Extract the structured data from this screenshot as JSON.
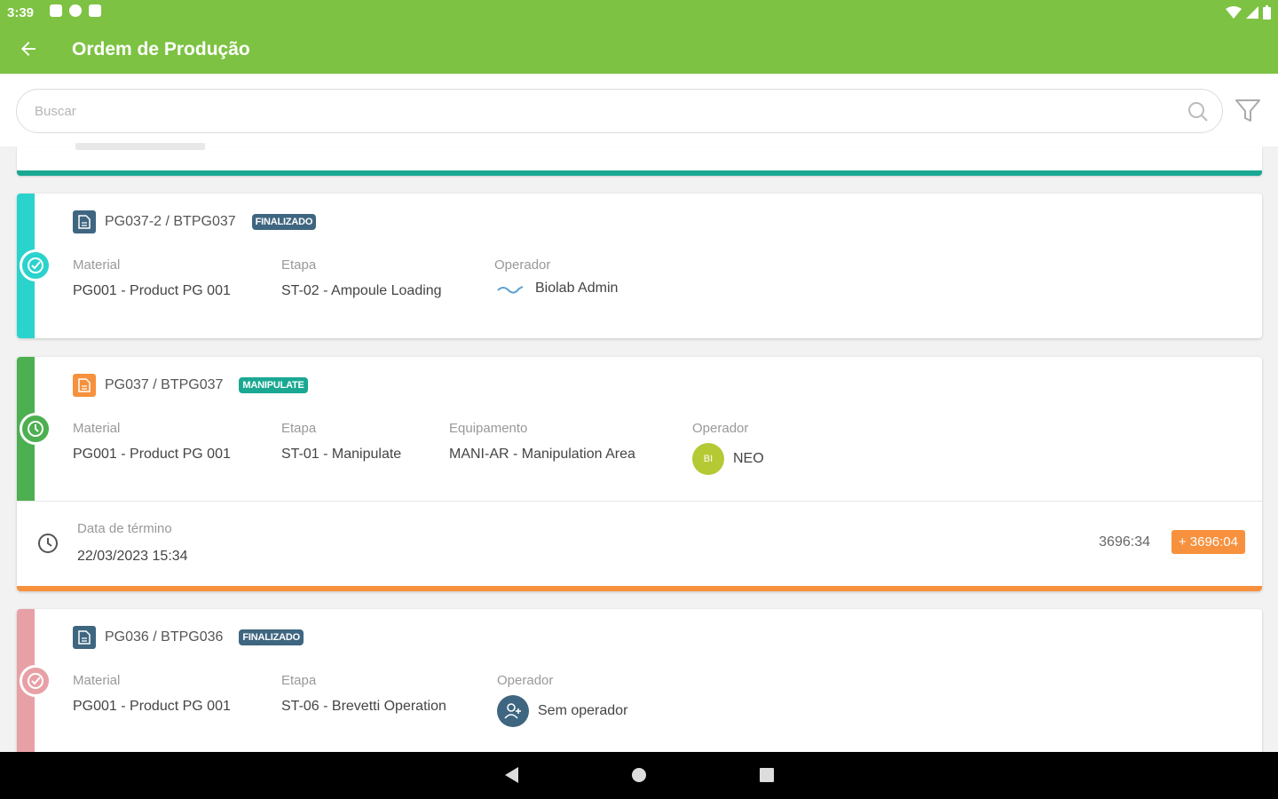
{
  "status_bar": {
    "time": "3:39"
  },
  "app_bar": {
    "title": "Ordem de Produção"
  },
  "search": {
    "placeholder": "Buscar"
  },
  "colors": {
    "brand": "#7dc242",
    "teal": "#2ad3cc",
    "green": "#4caf50",
    "pink": "#e7a1a6",
    "orange": "#f7913d",
    "badge_final": "#3f6680",
    "badge_manip": "#1aa893"
  },
  "cards": [
    {
      "code": "PG037-2 / BTPG037",
      "badge": "FINALIZADO",
      "material_label": "Material",
      "material": "PG001 - Product PG 001",
      "etapa_label": "Etapa",
      "etapa": "ST-02 - Ampoule Loading",
      "operador_label": "Operador",
      "operador": "Biolab Admin"
    },
    {
      "code": "PG037 / BTPG037",
      "badge": "MANIPULATE",
      "material_label": "Material",
      "material": "PG001 - Product PG 001",
      "etapa_label": "Etapa",
      "etapa": "ST-01 - Manipulate",
      "equip_label": "Equipamento",
      "equipamento": "MANI-AR - Manipulation Area",
      "operador_label": "Operador",
      "operador": "NEO",
      "operador_initials": "BI",
      "footer": {
        "label": "Data de término",
        "date": "22/03/2023 15:34",
        "duration": "3696:34",
        "late": "+ 3696:04"
      }
    },
    {
      "code": "PG036 / BTPG036",
      "badge": "FINALIZADO",
      "material_label": "Material",
      "material": "PG001 - Product PG 001",
      "etapa_label": "Etapa",
      "etapa": "ST-06 - Brevetti Operation",
      "operador_label": "Operador",
      "operador": "Sem operador"
    }
  ]
}
